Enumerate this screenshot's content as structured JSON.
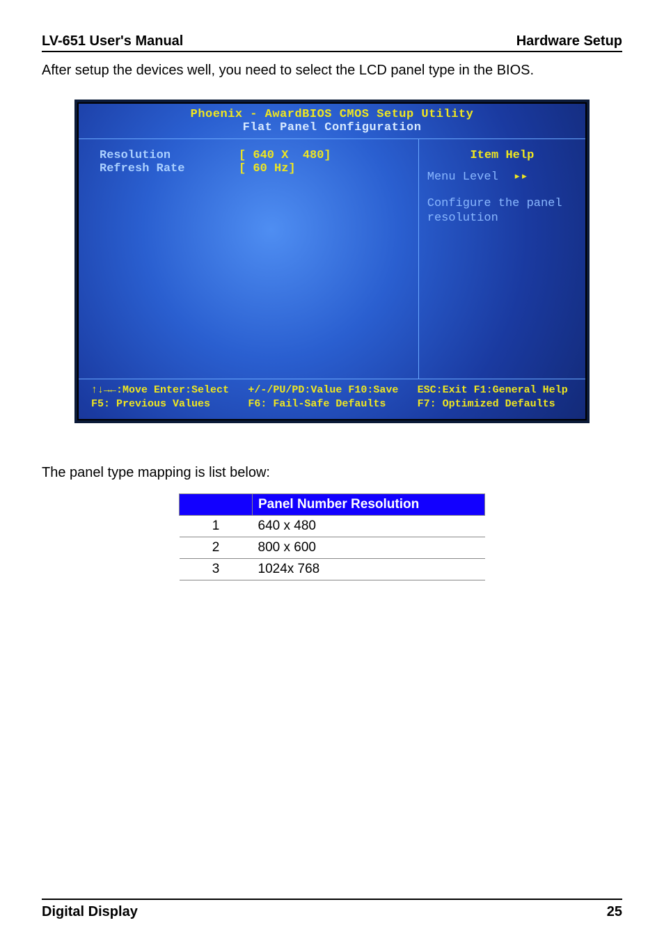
{
  "header": {
    "left": " LV-651 User's Manual",
    "right": "Hardware Setup "
  },
  "intro": "After setup the devices well, you need to select the LCD panel type in the BIOS.",
  "bios": {
    "title1": "Phoenix - AwardBIOS CMOS Setup Utility",
    "title2": "Flat Panel Configuration",
    "rows": [
      {
        "label": "Resolution",
        "value": "[ 640 X  480]"
      },
      {
        "label": "Refresh Rate",
        "value": "[ 60 Hz]"
      }
    ],
    "help": {
      "title": "Item Help",
      "menu_label": "Menu Level",
      "menu_arrows": "▸▸",
      "desc": "Configure the panel resolution"
    },
    "footer": {
      "line1a": "↑↓→←:Move  Enter:Select",
      "line1b": "+/-/PU/PD:Value  F10:Save",
      "line1c": "ESC:Exit  F1:General Help",
      "line2a": "F5: Previous Values",
      "line2b": "F6: Fail-Safe Defaults",
      "line2c": "F7: Optimized Defaults"
    }
  },
  "mapping_heading": "The panel type mapping is list below:",
  "table": {
    "header_blank": "",
    "header_res": "Panel Number Resolution",
    "rows": [
      {
        "num": "1",
        "res": "640 x 480"
      },
      {
        "num": "2",
        "res": "800 x 600"
      },
      {
        "num": "3",
        "res": "1024x 768"
      }
    ]
  },
  "footer": {
    "left": "Digital Display",
    "right": "25"
  }
}
